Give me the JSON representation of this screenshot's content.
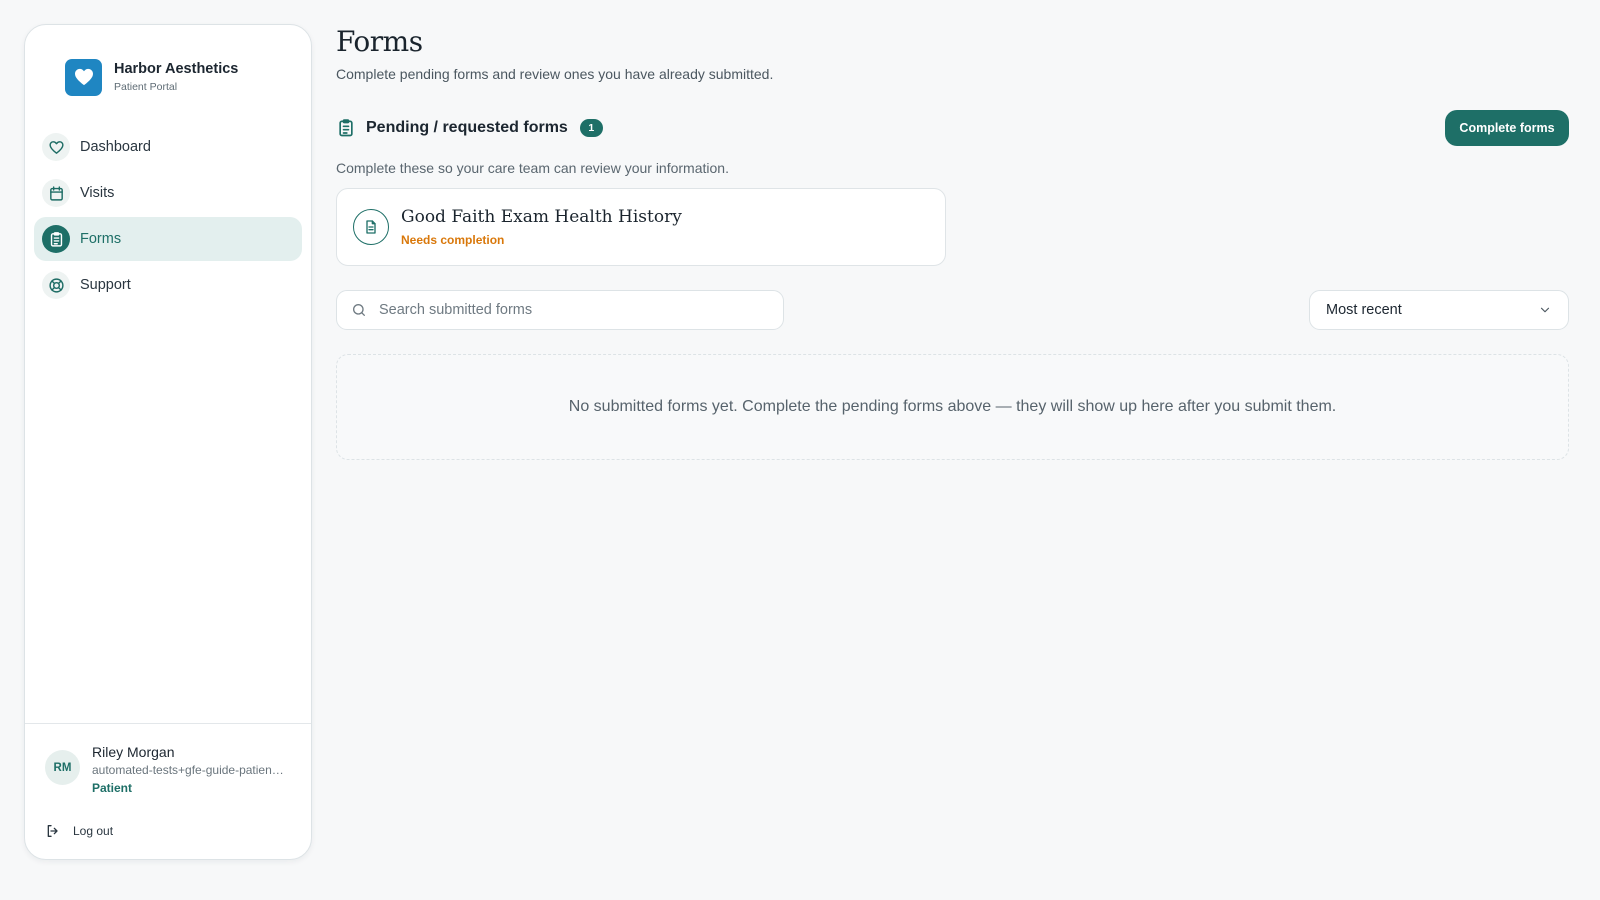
{
  "brand": {
    "name": "Harbor Aesthetics",
    "subtitle": "Patient Portal",
    "color": "#1f86c2"
  },
  "nav": {
    "items": [
      {
        "label": "Dashboard",
        "icon": "heart-icon",
        "active": false
      },
      {
        "label": "Visits",
        "icon": "calendar-icon",
        "active": false
      },
      {
        "label": "Forms",
        "icon": "clipboard-icon",
        "active": true
      },
      {
        "label": "Support",
        "icon": "lifebuoy-icon",
        "active": false
      }
    ]
  },
  "user": {
    "initials": "RM",
    "name": "Riley Morgan",
    "email": "automated-tests+gfe-guide-patient@harboraesthetics.test",
    "role": "Patient",
    "logout_label": "Log out"
  },
  "page": {
    "title": "Forms",
    "subtitle": "Complete pending forms and review ones you have already submitted."
  },
  "pending": {
    "title": "Pending / requested forms",
    "count": "1",
    "description": "Complete these so your care team can review your information.",
    "button_label": "Complete forms",
    "forms": [
      {
        "title": "Good Faith Exam Health History",
        "status": "Needs completion"
      }
    ]
  },
  "submitted": {
    "search_placeholder": "Search submitted forms",
    "sort_value": "Most recent",
    "empty_message": "No submitted forms yet. Complete the pending forms above — they will show up here after you submit them."
  },
  "colors": {
    "accent": "#1e6f67",
    "warning": "#d9780b",
    "background": "#f7f8f9"
  }
}
